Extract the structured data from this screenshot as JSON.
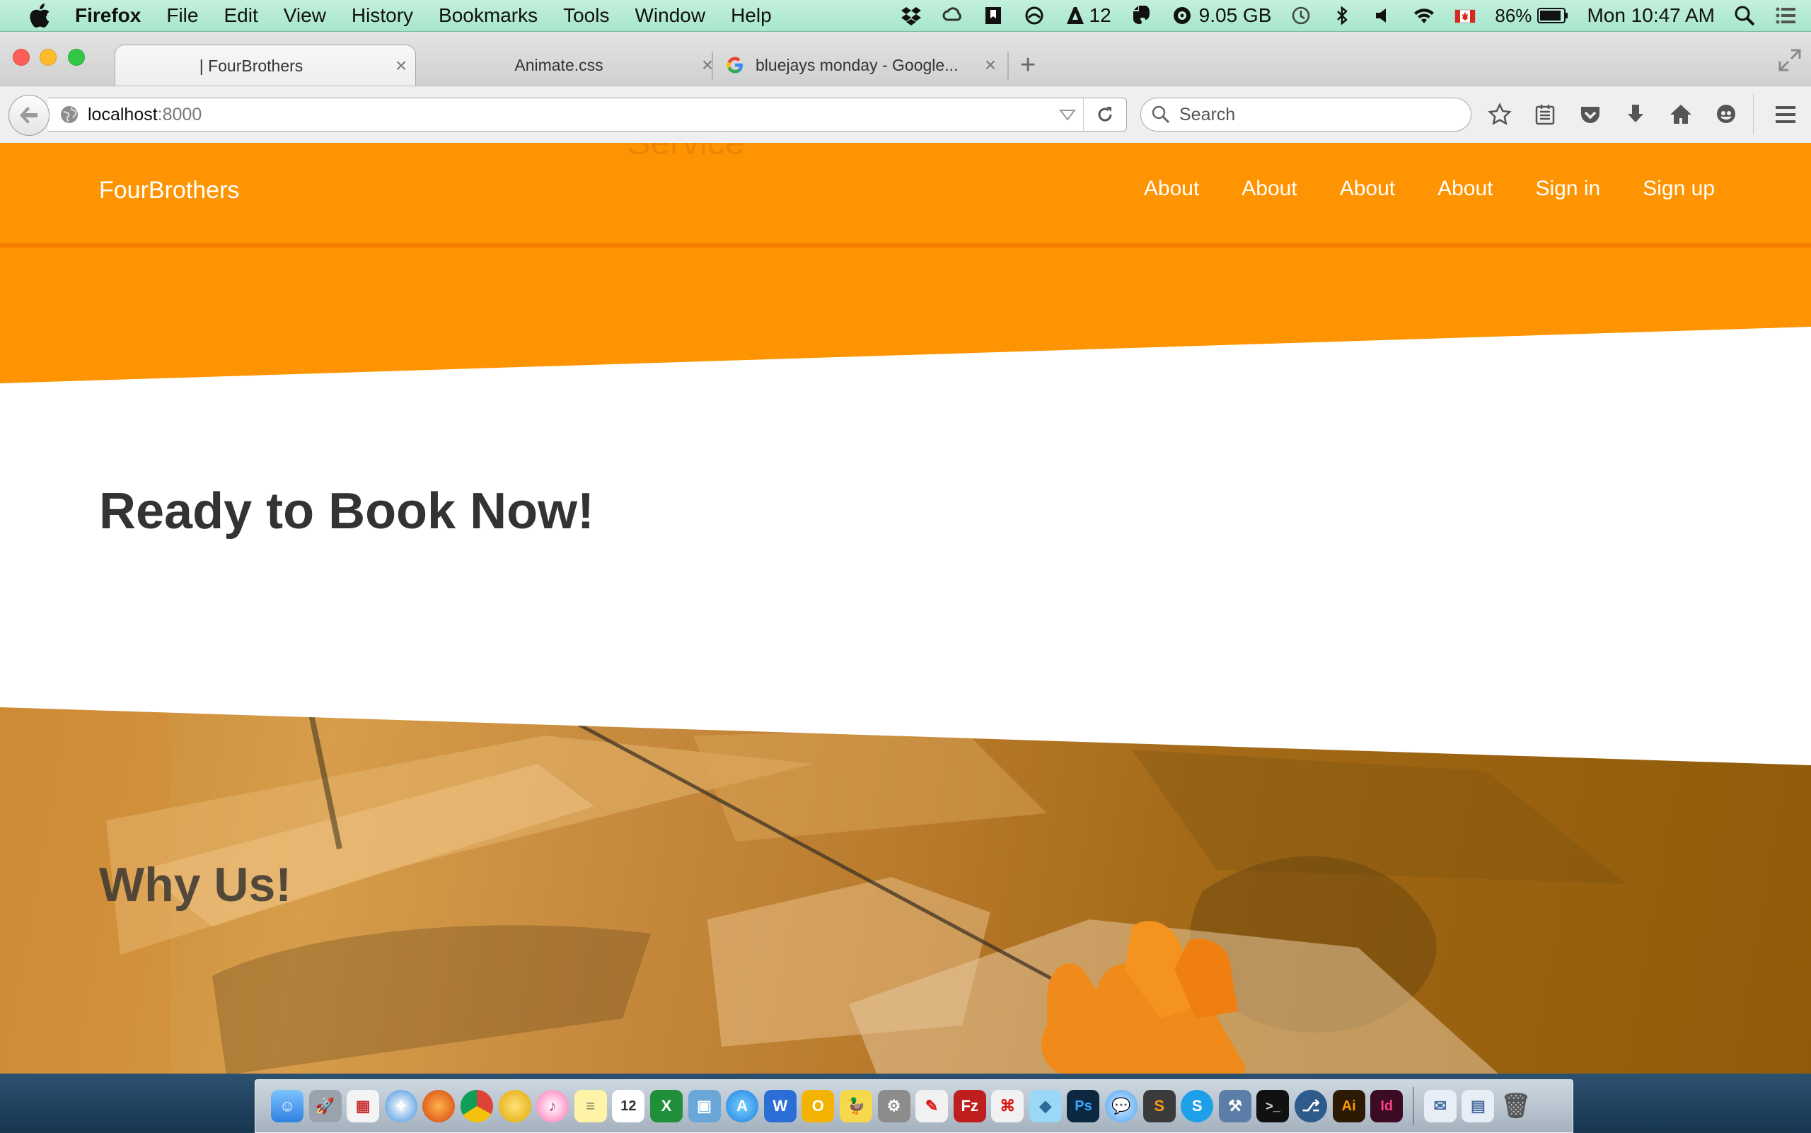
{
  "menubar": {
    "app_name": "Firefox",
    "items": [
      "File",
      "Edit",
      "View",
      "History",
      "Bookmarks",
      "Tools",
      "Window",
      "Help"
    ],
    "status": {
      "notification_count": "12",
      "storage": "9.05 GB",
      "battery": "86%",
      "clock": "Mon 10:47 AM"
    }
  },
  "browser": {
    "tabs": [
      {
        "label": "| FourBrothers",
        "active": true
      },
      {
        "label": "Animate.css",
        "active": false
      },
      {
        "label": "bluejays monday - Google...",
        "active": false
      }
    ],
    "url_host": "localhost",
    "url_port": ":8000",
    "search_placeholder": "Search"
  },
  "page": {
    "ghost_text": "Service",
    "brand": "FourBrothers",
    "nav_links": [
      "About",
      "About",
      "About",
      "About",
      "Sign in",
      "Sign up"
    ],
    "book_heading": "Ready to Book Now!",
    "why_heading": "Why Us!"
  },
  "colors": {
    "brand_orange": "#fe9402",
    "nav_border": "#f57c00",
    "heading_text": "#333333"
  },
  "dock": {
    "apps": [
      "finder-icon",
      "launchpad-icon",
      "calendar-grid-icon",
      "safari-icon",
      "firefox-icon",
      "chrome-icon",
      "canary-icon",
      "itunes-icon",
      "notes-icon",
      "calendar-icon",
      "excel-icon",
      "preview-icon",
      "appstore-icon",
      "word-icon",
      "outlook-icon",
      "cyberduck-icon",
      "system-prefs-icon",
      "acrobat-icon",
      "filezilla-icon",
      "pdf-icon",
      "sketch-icon",
      "photoshop-icon",
      "messages-icon",
      "sublime-icon",
      "skype-icon",
      "xcode-icon",
      "terminal-icon",
      "sourcetree-icon",
      "illustrator-icon",
      "indesign-icon"
    ],
    "calendar_day": "12"
  }
}
